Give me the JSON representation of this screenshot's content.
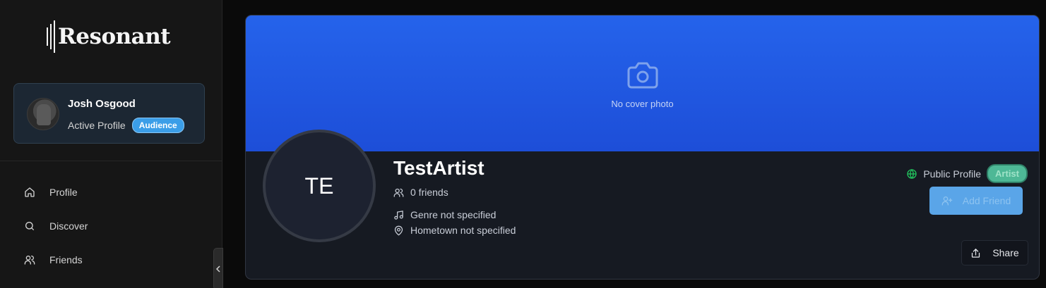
{
  "sidebar": {
    "logo_text": "Resonant",
    "profile_card": {
      "name": "Josh Osgood",
      "status": "Active Profile",
      "badge": "Audience"
    },
    "nav": [
      {
        "label": "Profile",
        "icon": "home-icon"
      },
      {
        "label": "Discover",
        "icon": "search-icon"
      },
      {
        "label": "Friends",
        "icon": "users-icon"
      }
    ]
  },
  "profile": {
    "cover_text": "No cover photo",
    "initials": "TE",
    "name": "TestArtist",
    "friends": "0 friends",
    "genre": "Genre not specified",
    "hometown": "Hometown not specified",
    "visibility": "Public Profile",
    "type_badge": "Artist",
    "add_friend_label": "Add Friend",
    "share_label": "Share"
  },
  "colors": {
    "cover": "#2563eb",
    "audience_badge": "#3b9ee8",
    "artist_badge": "#4eb896",
    "add_friend": "#5aa5e8",
    "globe": "#22c55e"
  }
}
